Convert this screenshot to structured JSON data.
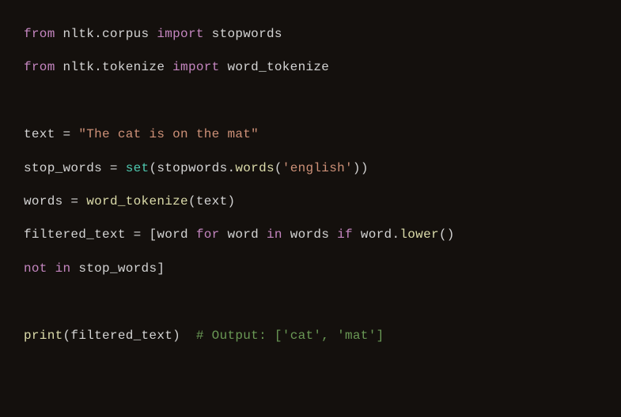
{
  "code": {
    "line1": {
      "from": "from",
      "module1": " nltk.corpus ",
      "import": "import",
      "name1": " stopwords"
    },
    "line2": {
      "from": "from",
      "module2": " nltk.tokenize ",
      "import": "import",
      "name2": " word_tokenize"
    },
    "line3": {
      "lhs": "text ",
      "eq": "=",
      "sp": " ",
      "str": "\"The cat is on the mat\""
    },
    "line4": {
      "lhs": "stop_words ",
      "eq": "=",
      "sp": " ",
      "set": "set",
      "paren1": "(",
      "mid": "stopwords.",
      "wordsfn": "words",
      "paren2": "(",
      "arg": "'english'",
      "close": "))"
    },
    "line5": {
      "lhs": "words ",
      "eq": "=",
      "sp": " ",
      "fn": "word_tokenize",
      "open": "(",
      "arg": "text",
      "close": ")"
    },
    "line6": {
      "lhs": "filtered_text ",
      "eq": "=",
      "sp": " ",
      "open": "[",
      "word1": "word ",
      "for": "for",
      "word2": " word ",
      "in1": "in",
      "words": " words ",
      "if": "if",
      "tail": " word.",
      "lower": "lower",
      "parens": "()"
    },
    "line7": {
      "not": "not",
      "sp1": " ",
      "in": "in",
      "sw": " stop_words",
      "close": "]"
    },
    "line8": {
      "print": "print",
      "open": "(",
      "arg": "filtered_text",
      "close": ")  ",
      "comment": "# Output: ['cat', 'mat']"
    }
  }
}
